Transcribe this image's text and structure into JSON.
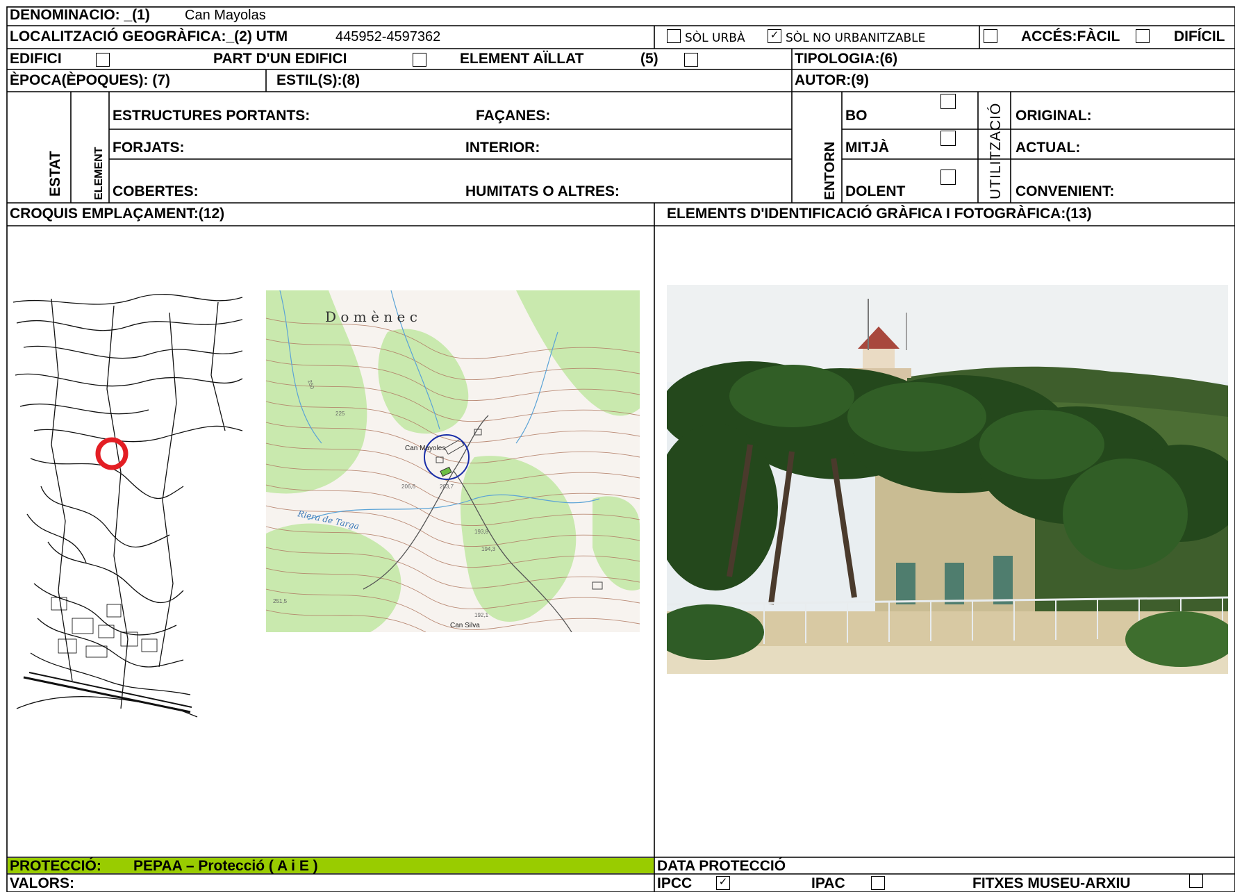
{
  "header": {
    "denominacio_label": "DENOMINACIO: _(1)",
    "denominacio_value": "Can Mayolas",
    "localitzacio_label": "LOCALITZACIÓ GEOGRÀFICA:_(2) UTM",
    "localitzacio_value": "445952-4597362",
    "sol_urba": "SÒL URBÀ",
    "sol_urba_checked": false,
    "sol_no_urb": "SÒL NO URBANITZABLE",
    "sol_no_urb_checked": true,
    "acces_facil": "ACCÉS:FÀCIL",
    "acces_dificil": "DIFÍCIL"
  },
  "row3": {
    "edifici": "EDIFICI",
    "part_edifici": "PART D'UN EDIFICI",
    "element_aillat": "ELEMENT AÏLLAT",
    "num5": "(5)",
    "tipologia": "TIPOLOGIA:(6)"
  },
  "row4": {
    "epoca": "ÈPOCA(ÈPOQUES): (7)",
    "estil": "ESTIL(S):(8)",
    "autor": "AUTOR:(9)"
  },
  "estat": {
    "estat_label": "ESTAT",
    "element_label": "ELEMENT",
    "estructures": "ESTRUCTURES PORTANTS:",
    "facanes": "FAÇANES:",
    "forjats": "FORJATS:",
    "interior": "INTERIOR:",
    "cobertes": "COBERTES:",
    "humitats": "HUMITATS O ALTRES:",
    "entorn_label": "ENTORN",
    "bo": "BO",
    "mitja": "MITJÀ",
    "dolent": "DOLENT",
    "utilitzacio_label": "UTILITZACIÓ",
    "original": "ORIGINAL:",
    "actual": "ACTUAL:",
    "convenient": "CONVENIENT:"
  },
  "sections": {
    "croquis": "CROQUIS EMPLAÇAMENT:(12)",
    "elements": "ELEMENTS D'IDENTIFICACIÓ GRÀFICA I FOTOGRÀFICA:(13)"
  },
  "map": {
    "place1": "D o m è n e c",
    "can_mayoles": "Can Mayoles",
    "riera": "Riera de Targa",
    "can_silva": "Can Silva",
    "e225": "225",
    "e250": "250",
    "e2066": "206,6",
    "e2037": "203,7",
    "e1938": "193,8",
    "e1943": "194,3",
    "e1921": "192,1",
    "e2515": "251,5"
  },
  "footer": {
    "proteccio_label": "PROTECCIÓ:",
    "proteccio_value": "PEPAA – Protecció ( A i E )",
    "proteccio_color": "#99CC00",
    "data_proteccio": "DATA PROTECCIÓ",
    "valors": "VALORS:",
    "ipcc": "IPCC",
    "ipcc_checked": true,
    "ipac": "IPAC",
    "fitxes": "FITXES MUSEU-ARXIU"
  },
  "icons": {
    "check": "✓"
  }
}
